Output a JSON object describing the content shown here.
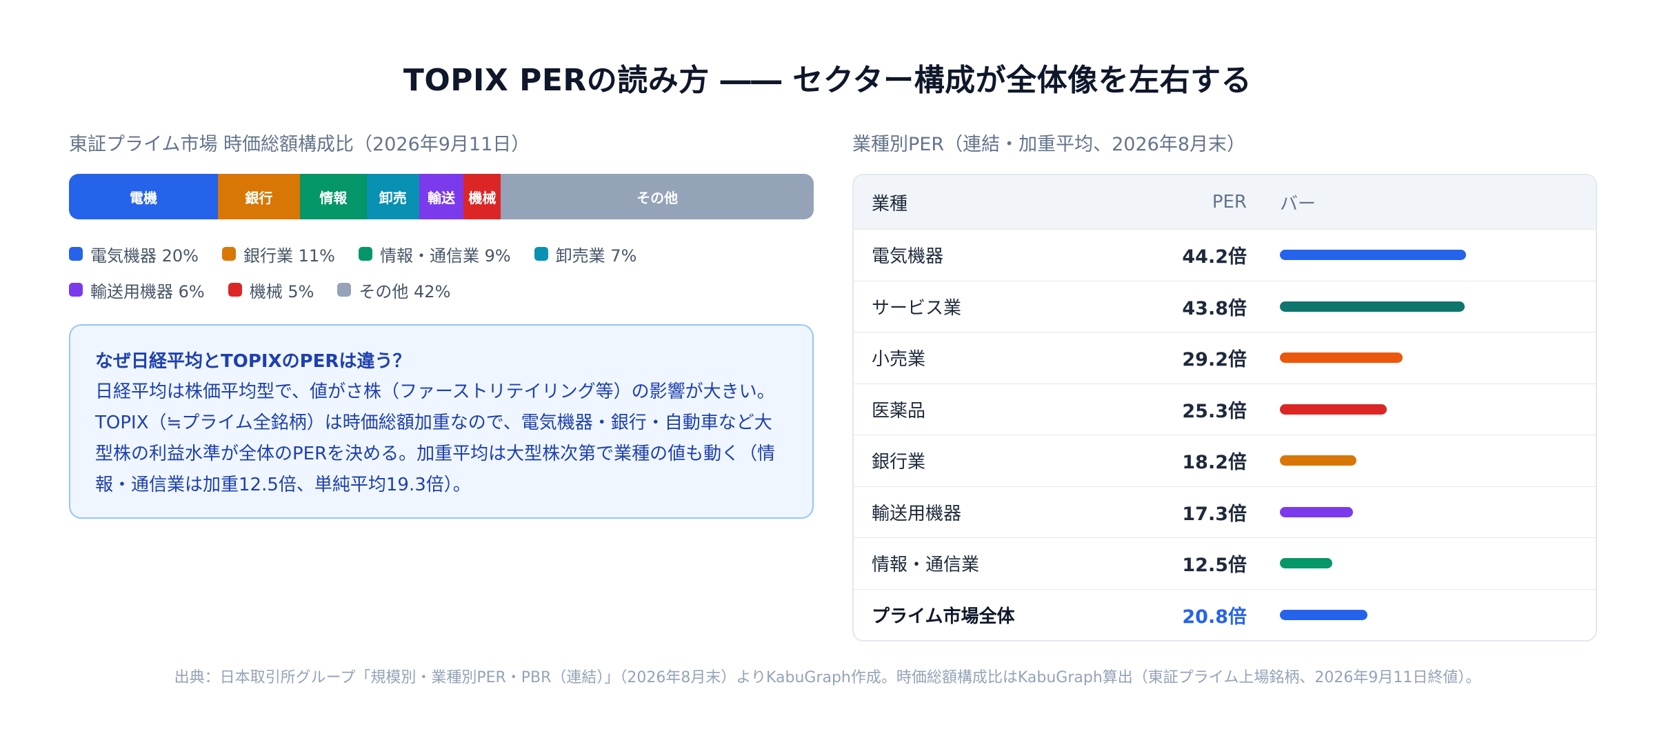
{
  "title": "TOPIX PERの読み方 ―― セクター構成が全体像を左右する",
  "left": {
    "subtitle": "東証プライム市場 時価総額構成比（2026年9月11日）",
    "note": {
      "heading": "なぜ日経平均とTOPIXのPERは違う？",
      "lines": [
        "日経平均は株価平均型で、値がさ株（ファーストリテイリング等）の影響が大きい。",
        "TOPIX（≒プライム全銘柄）は時価総額加重なので、電気機器・銀行・自動車など大",
        "型株の利益水準が全体のPERを決める。加重平均は大型株次第で業種の値も動く（情",
        "報・通信業は加重12.5倍、単純平均19.3倍）。"
      ]
    }
  },
  "right": {
    "subtitle": "業種別PER（連結・加重平均、2026年8月末）",
    "headers": {
      "name": "業種",
      "per": "PER",
      "bar": "バー"
    }
  },
  "source": "出典：日本取引所グループ「規模別・業種別PER・PBR（連結）」（2026年8月末）よりKabuGraph作成。時価総額構成比はKabuGraph算出（東証プライム上場銘柄、2026年9月11日終値）。",
  "chart_data": [
    {
      "type": "bar",
      "orientation": "horizontal-stacked",
      "title": "東証プライム市場 時価総額構成比（2026年9月11日）",
      "segments": [
        {
          "short": "電機",
          "name": "電気機器",
          "value": 20,
          "label": "電気機器 20%",
          "color": "#2563eb"
        },
        {
          "short": "銀行",
          "name": "銀行業",
          "value": 11,
          "label": "銀行業 11%",
          "color": "#d97706"
        },
        {
          "short": "情報",
          "name": "情報・通信業",
          "value": 9,
          "label": "情報・通信業 9%",
          "color": "#059669"
        },
        {
          "short": "卸売",
          "name": "卸売業",
          "value": 7,
          "label": "卸売業 7%",
          "color": "#0891b2"
        },
        {
          "short": "輸送",
          "name": "輸送用機器",
          "value": 6,
          "label": "輸送用機器 6%",
          "color": "#7c3aed"
        },
        {
          "short": "機械",
          "name": "機械",
          "value": 5,
          "label": "機械 5%",
          "color": "#dc2626"
        },
        {
          "short": "その他",
          "name": "その他",
          "value": 42,
          "label": "その他 42%",
          "color": "#94a3b8"
        }
      ]
    },
    {
      "type": "bar",
      "orientation": "horizontal",
      "title": "業種別PER（連結・加重平均、2026年8月末）",
      "xlim": [
        0,
        44.2
      ],
      "rows": [
        {
          "name": "電気機器",
          "value": 44.2,
          "label": "44.2倍",
          "color": "#2563eb"
        },
        {
          "name": "サービス業",
          "value": 43.8,
          "label": "43.8倍",
          "color": "#0f766e"
        },
        {
          "name": "小売業",
          "value": 29.2,
          "label": "29.2倍",
          "color": "#ea580c"
        },
        {
          "name": "医薬品",
          "value": 25.3,
          "label": "25.3倍",
          "color": "#dc2626"
        },
        {
          "name": "銀行業",
          "value": 18.2,
          "label": "18.2倍",
          "color": "#d97706"
        },
        {
          "name": "輸送用機器",
          "value": 17.3,
          "label": "17.3倍",
          "color": "#7c3aed"
        },
        {
          "name": "情報・通信業",
          "value": 12.5,
          "label": "12.5倍",
          "color": "#059669"
        },
        {
          "name": "プライム市場全体",
          "value": 20.8,
          "label": "20.8倍",
          "color": "#2563eb",
          "total": true
        }
      ]
    }
  ]
}
